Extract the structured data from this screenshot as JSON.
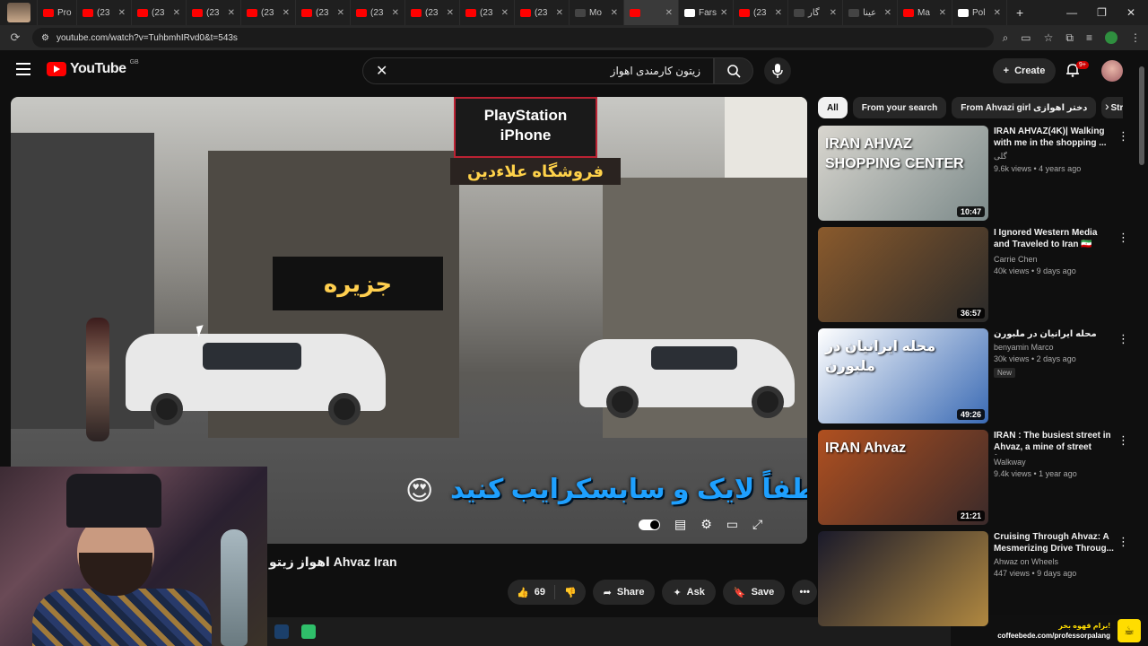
{
  "browser": {
    "tabs": [
      {
        "label": "Pro",
        "favicon": "avatar"
      },
      {
        "label": "(23",
        "favicon": "youtube"
      },
      {
        "label": "(23",
        "favicon": "youtube"
      },
      {
        "label": "(23",
        "favicon": "youtube"
      },
      {
        "label": "(23",
        "favicon": "youtube"
      },
      {
        "label": "(23",
        "favicon": "youtube"
      },
      {
        "label": "(23",
        "favicon": "youtube"
      },
      {
        "label": "(23",
        "favicon": "youtube"
      },
      {
        "label": "(23",
        "favicon": "youtube"
      },
      {
        "label": "(23",
        "favicon": "youtube"
      },
      {
        "label": "Mo",
        "favicon": "dark"
      },
      {
        "label": "",
        "favicon": "youtube",
        "active": true
      },
      {
        "label": "Fars",
        "favicon": "wiki"
      },
      {
        "label": "(23",
        "favicon": "youtube"
      },
      {
        "label": "گار",
        "favicon": "dark"
      },
      {
        "label": "عینا",
        "favicon": "dark"
      },
      {
        "label": "Ma",
        "favicon": "youtube"
      },
      {
        "label": "Pol",
        "favicon": "wiki"
      }
    ],
    "url": "youtube.com/watch?v=TuhbmhIRvd0&t=543s"
  },
  "header": {
    "logo_text": "YouTube",
    "country_code": "GB",
    "search_value": "زیتون کارمندی اهواز",
    "create_label": "Create",
    "notification_count": "9+"
  },
  "video": {
    "sign_top": "PlayStation\niPhone",
    "sign_farsi": "فروشگاه علاءدین",
    "sign_jazireh": "جزیره",
    "subtitle": "لطفاً لایک و سابسکرایب کنید",
    "subtitle_emoji": "😍",
    "title": "اهواز زیتو Ahvaz Iran",
    "likes": "69",
    "share_label": "Share",
    "ask_label": "Ask",
    "save_label": "Save"
  },
  "chips": [
    {
      "label": "All",
      "active": true
    },
    {
      "label": "From your search"
    },
    {
      "label": "From Ahvazi girl دختر اهوازی"
    },
    {
      "label": "Str"
    }
  ],
  "recommendations": [
    {
      "title": "IRAN AHVAZ(4K)| Walking with me in the shopping ...",
      "channel": "گلی",
      "meta": "9.6k views • 4 years ago",
      "duration": "10:47",
      "thumb_text": "IRAN AHVAZ SHOPPING CENTER",
      "thumb_colors": [
        "#d9d6cf",
        "#7c8a8a"
      ]
    },
    {
      "title": "I Ignored Western Media and Traveled to Iran 🇮🇷 Here's ...",
      "channel": "Carrie Chen",
      "meta": "40k views • 9 days ago",
      "duration": "36:57",
      "thumb_text": "",
      "thumb_colors": [
        "#8a5a2c",
        "#2a2a2a"
      ]
    },
    {
      "title": "محله ایرانیان در ملبورن",
      "channel": "benyamin Marco",
      "meta": "30k views • 2 days ago",
      "duration": "49:26",
      "thumb_text": "محله ایرانیان در ملبورن",
      "thumb_colors": [
        "#ffffff",
        "#3a6ab4"
      ],
      "badge": "New"
    },
    {
      "title": "IRAN : The busiest street in Ahvaz, a mine of street foo...",
      "channel": "Walkway",
      "meta": "9.4k views • 1 year ago",
      "duration": "21:21",
      "thumb_text": "IRAN Ahvaz",
      "thumb_colors": [
        "#b05020",
        "#3a2a2a"
      ]
    },
    {
      "title": "Cruising Through Ahvaz: A Mesmerizing Drive Throug...",
      "channel": "Ahwaz on Wheels",
      "meta": "447 views • 9 days ago",
      "duration": "",
      "thumb_text": "",
      "thumb_colors": [
        "#1a1a2a",
        "#b08840"
      ]
    }
  ],
  "overlay": {
    "coffee_line1": "برام قهوه بخر!",
    "coffee_line2": "coffeebede.com/professorpalang"
  },
  "icons": {
    "search": "search-icon",
    "mic": "mic-icon",
    "bell": "bell-icon",
    "menu": "hamburger-icon"
  }
}
